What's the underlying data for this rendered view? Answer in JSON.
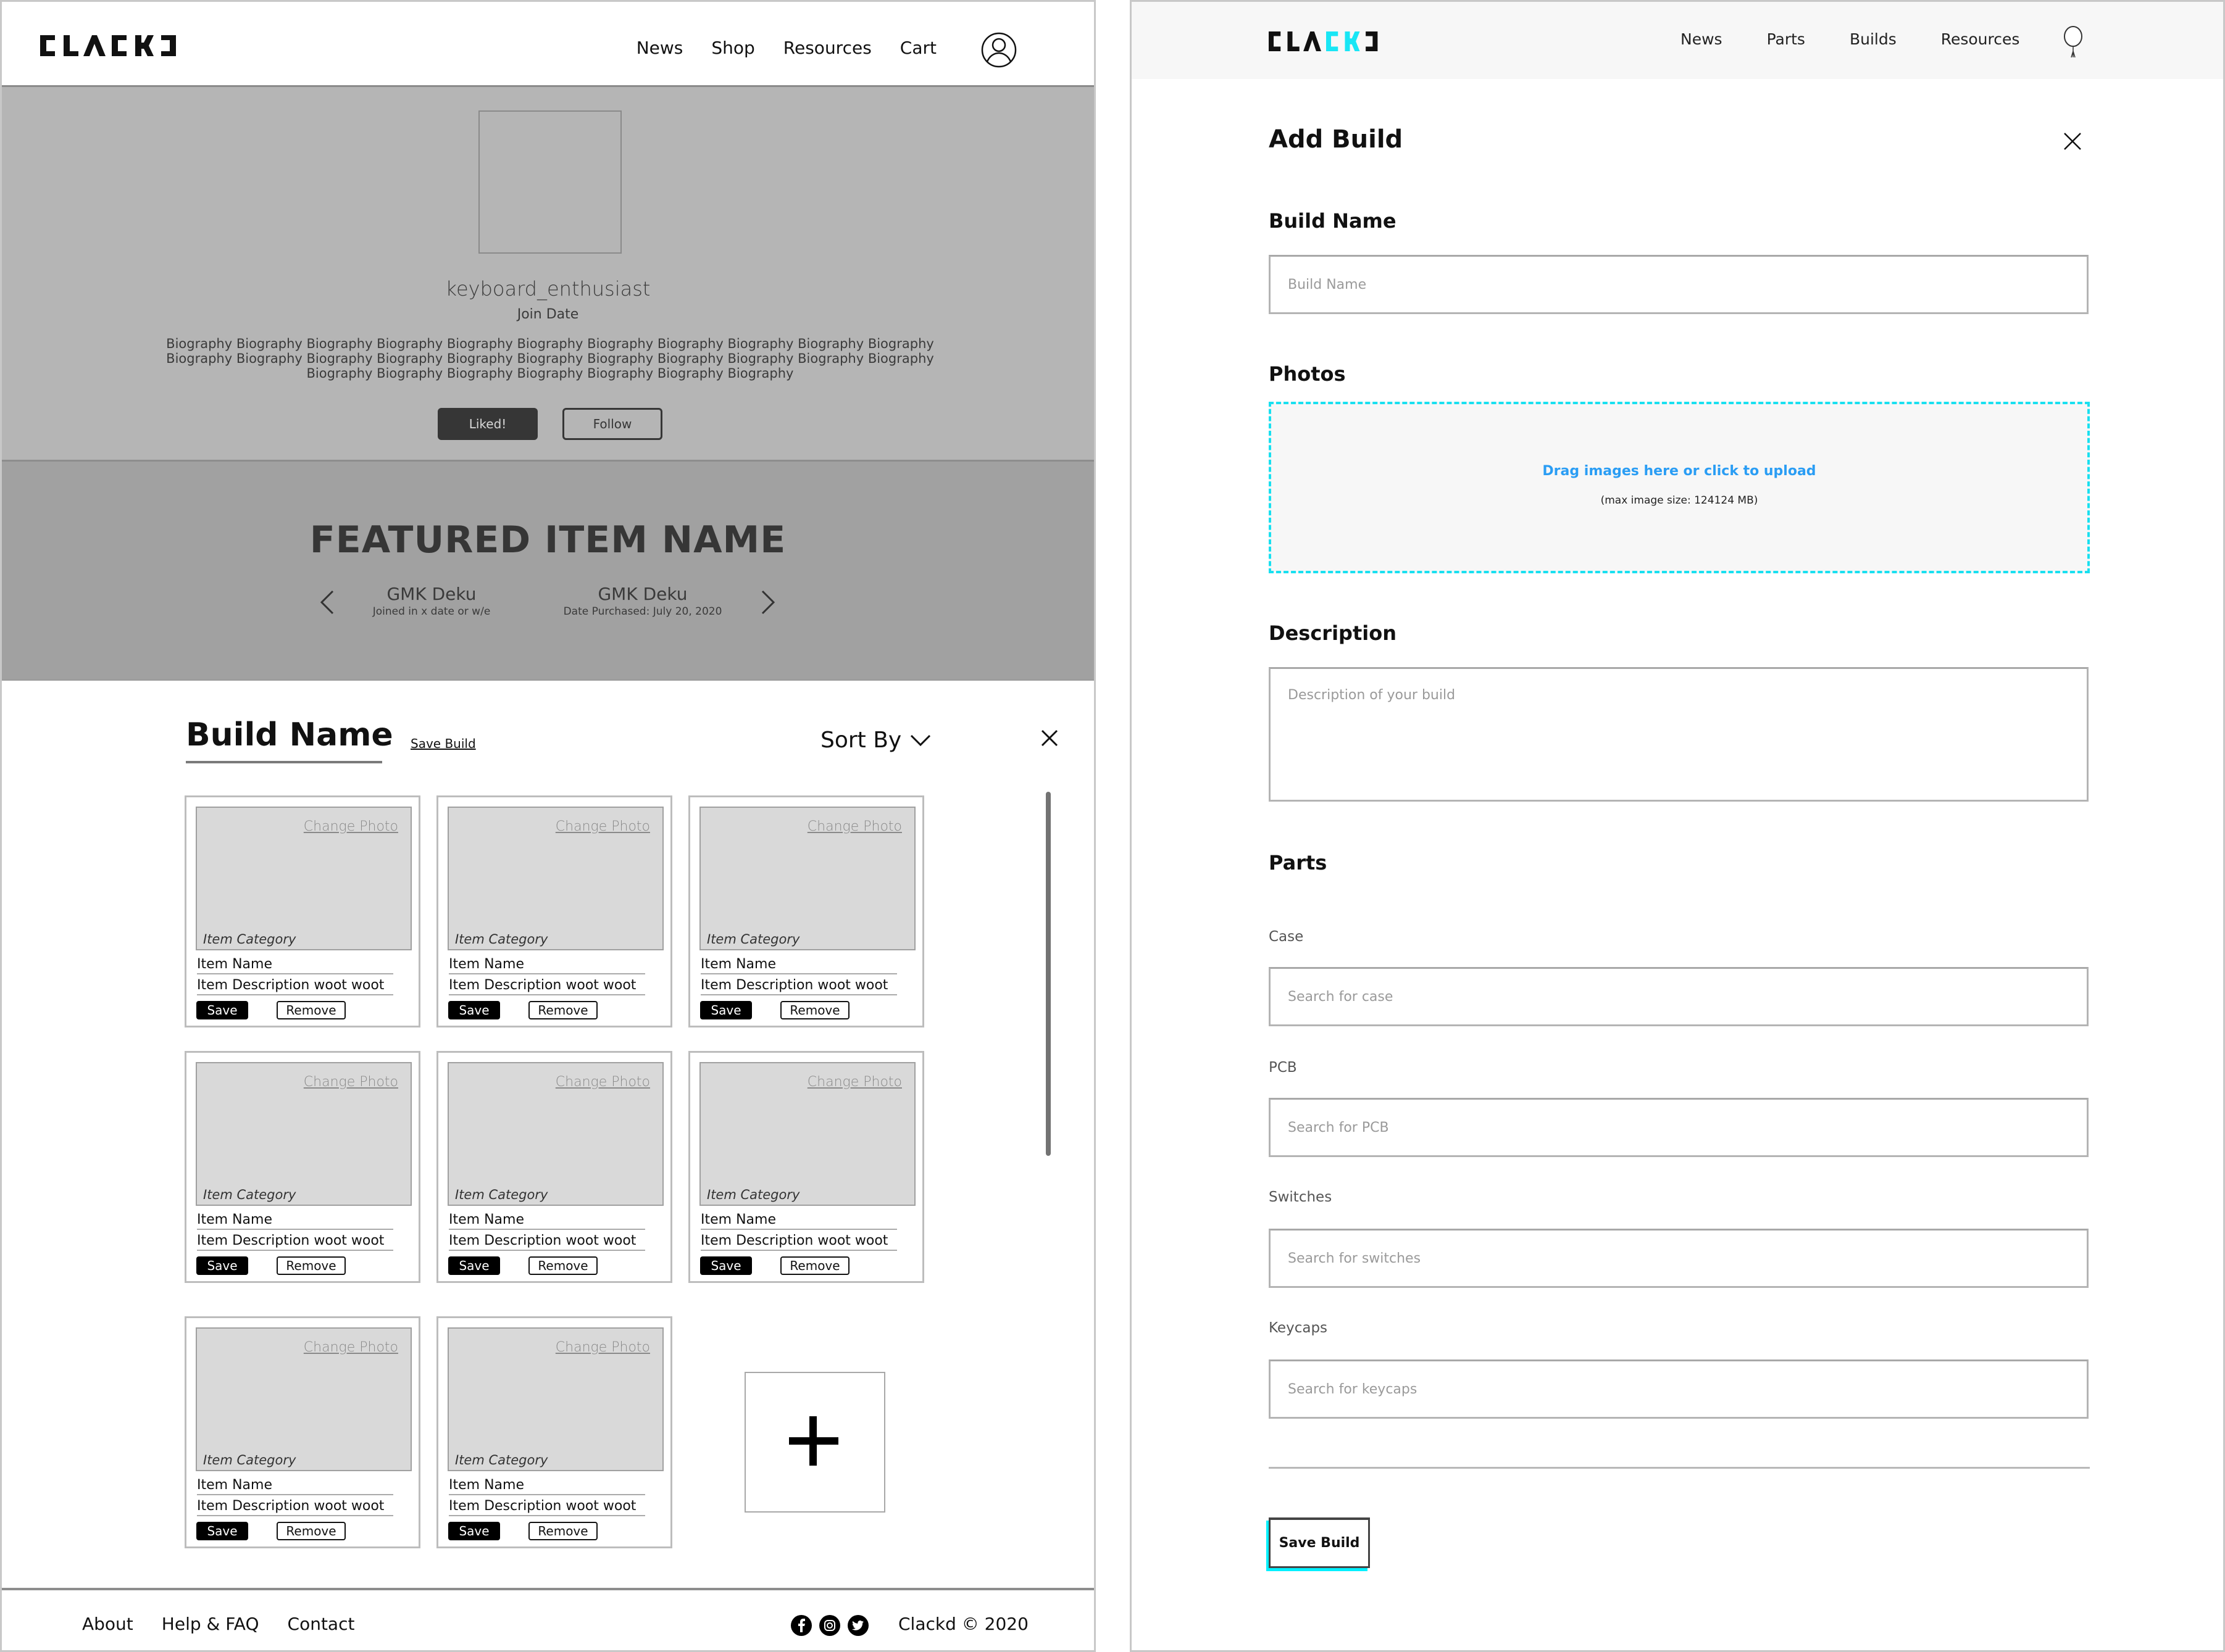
{
  "left": {
    "header": {
      "logo_text": "CLACKD",
      "nav": [
        {
          "label": "News"
        },
        {
          "label": "Shop"
        },
        {
          "label": "Resources"
        },
        {
          "label": "Cart"
        }
      ],
      "user_icon": "user-circle-icon"
    },
    "profile": {
      "username": "keyboard_enthusiast",
      "join_date": "Join Date",
      "bio": "Biography Biography Biography Biography Biography Biography Biography Biography Biography Biography Biography Biography Biography Biography Biography Biography Biography Biography Biography Biography Biography Biography Biography Biography Biography Biography Biography Biography Biography",
      "liked_label": "Liked!",
      "follow_label": "Follow"
    },
    "featured": {
      "title": "FEATURED ITEM NAME",
      "items": [
        {
          "name": "GMK Deku",
          "subtitle": "Joined in x date or w/e"
        },
        {
          "name": "GMK Deku",
          "subtitle": "Date Purchased: July 20, 2020"
        }
      ]
    },
    "build": {
      "title": "Build Name",
      "save_link": "Save Build",
      "sort_label": "Sort By",
      "cards": [
        {
          "change_photo": "Change Photo",
          "category": "Item Category",
          "name": "Item Name",
          "description": "Item Description woot woot",
          "save": "Save",
          "remove": "Remove"
        },
        {
          "change_photo": "Change Photo",
          "category": "Item Category",
          "name": "Item Name",
          "description": "Item Description woot woot",
          "save": "Save",
          "remove": "Remove"
        },
        {
          "change_photo": "Change Photo",
          "category": "Item Category",
          "name": "Item Name",
          "description": "Item Description woot woot",
          "save": "Save",
          "remove": "Remove"
        },
        {
          "change_photo": "Change Photo",
          "category": "Item Category",
          "name": "Item Name",
          "description": "Item Description woot woot",
          "save": "Save",
          "remove": "Remove"
        },
        {
          "change_photo": "Change Photo",
          "category": "Item Category",
          "name": "Item Name",
          "description": "Item Description woot woot",
          "save": "Save",
          "remove": "Remove"
        },
        {
          "change_photo": "Change Photo",
          "category": "Item Category",
          "name": "Item Name",
          "description": "Item Description woot woot",
          "save": "Save",
          "remove": "Remove"
        },
        {
          "change_photo": "Change Photo",
          "category": "Item Category",
          "name": "Item Name",
          "description": "Item Description woot woot",
          "save": "Save",
          "remove": "Remove"
        },
        {
          "change_photo": "Change Photo",
          "category": "Item Category",
          "name": "Item Name",
          "description": "Item Description woot woot",
          "save": "Save",
          "remove": "Remove"
        }
      ]
    },
    "footer": {
      "links": [
        {
          "label": "About"
        },
        {
          "label": "Help & FAQ"
        },
        {
          "label": "Contact"
        }
      ],
      "socials": [
        "facebook-icon",
        "instagram-icon",
        "twitter-icon"
      ],
      "copyright": "Clackd © 2020"
    }
  },
  "right": {
    "header": {
      "logo_text": "CLACKD",
      "nav": [
        {
          "label": "News"
        },
        {
          "label": "Parts"
        },
        {
          "label": "Builds"
        },
        {
          "label": "Resources"
        }
      ],
      "profile_icon": "balloon-icon"
    },
    "form": {
      "title": "Add Build",
      "build_name_label": "Build Name",
      "build_name_placeholder": "Build Name",
      "build_name_value": "",
      "photos_label": "Photos",
      "dropzone_text": "Drag images here or click to upload",
      "dropzone_subtext": "(max image size: 124124 MB)",
      "description_label": "Description",
      "description_placeholder": "Description of your build",
      "description_value": "",
      "parts_label": "Parts",
      "parts": [
        {
          "label": "Case",
          "placeholder": "Search for case",
          "value": ""
        },
        {
          "label": "PCB",
          "placeholder": "Search for PCB",
          "value": ""
        },
        {
          "label": "Switches",
          "placeholder": "Search for switches",
          "value": ""
        },
        {
          "label": "Keycaps",
          "placeholder": "Search for keycaps",
          "value": ""
        }
      ],
      "save_button": "Save Build"
    }
  },
  "colors": {
    "accent_cyan": "#00f0ff",
    "link_blue": "#2a9df4",
    "profile_bg": "#b5b5b5",
    "featured_bg": "#a1a1a1",
    "dark_button": "#363636"
  }
}
